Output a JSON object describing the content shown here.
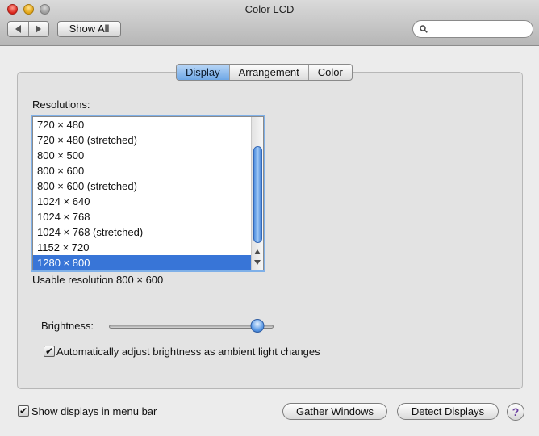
{
  "window": {
    "title": "Color LCD"
  },
  "toolbar": {
    "show_all_label": "Show All",
    "search_placeholder": ""
  },
  "tabs": [
    {
      "label": "Display",
      "active": true
    },
    {
      "label": "Arrangement",
      "active": false
    },
    {
      "label": "Color",
      "active": false
    }
  ],
  "resolutions": {
    "label": "Resolutions:",
    "items": [
      "720 × 480",
      "720 × 480 (stretched)",
      "800 × 500",
      "800 × 600",
      "800 × 600 (stretched)",
      "1024 × 640",
      "1024 × 768",
      "1024 × 768 (stretched)",
      "1152 × 720",
      "1280 × 800"
    ],
    "selected": "1280 × 800",
    "usable_text": "Usable resolution 800 × 600"
  },
  "brightness": {
    "label": "Brightness:",
    "level": 0.9,
    "auto_adjust_label": "Automatically adjust brightness as ambient light changes",
    "auto_adjust_checked": true
  },
  "footer": {
    "show_in_menu_bar_label": "Show displays in menu bar",
    "show_in_menu_bar_checked": true,
    "gather_windows_label": "Gather Windows",
    "detect_displays_label": "Detect Displays",
    "help_label": "?"
  },
  "colors": {
    "accent": "#3875d7",
    "tab_active": "#6ea7e6",
    "help_glyph": "#6b3fa0"
  }
}
